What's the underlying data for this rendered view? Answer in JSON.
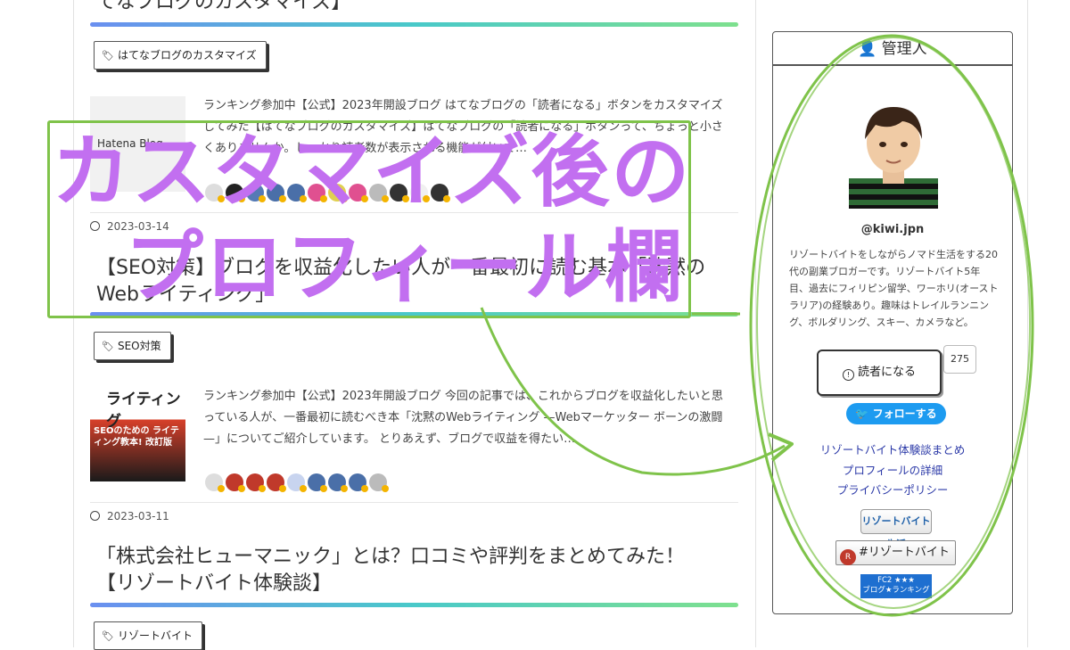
{
  "articles": {
    "a1": {
      "title_partial": "てなブログのカスタマイズ】",
      "tag": "はてなブログのカスタマイズ",
      "excerpt": "ランキング参加中【公式】2023年開設ブログ はてなブログの「読者になる」ボタンをカスタマイズしてみた【はてなブログのカスタマイズ】はてなブログの「読者になる」ボタンって、ちょっと小さくありませんか。しっかり読者数が表示される機能が付いて…",
      "thumb_label": "Hatena Blog"
    },
    "a2": {
      "date": "2023-03-14",
      "title": "【SEO対策】ブログを収益化したい人が一番最初に読む基本「沈黙のWebライティング」",
      "tag": "SEO対策",
      "excerpt": "ランキング参加中【公式】2023年開設ブログ 今回の記事では、これからブログを収益化したいと思っている人が、一番最初に読むべき本「沈黙のWebライティング —Webマーケッター ボーンの激闘—」についてご紹介しています。 とりあえず、ブログで収益を得たい…",
      "book_title": "ライティング",
      "book_sub": "SEOのための ライティング教本! 改訂版"
    },
    "a3": {
      "date": "2023-03-11",
      "title": "「株式会社ヒューマニック」とは？口コミや評判をまとめてみた！【リゾートバイト体験談】",
      "tag": "リゾートバイト"
    }
  },
  "profile": {
    "header": "管理人",
    "username": "@kiwi.jpn",
    "bio": "リゾートバイトをしながらノマド生活をする20代の副業ブロガーです。リゾートバイト5年目、過去にフィリピン留学、ワーホリ(オーストラリア)の経験あり。趣味はトレイルランニング、ボルダリング、スキー、カメラなど。",
    "read_button": "読者になる",
    "reader_count": "275",
    "follow_button": "フォローする",
    "links": [
      "リゾートバイト体験談まとめ",
      "プロフィールの詳細",
      "プライバシーポリシー"
    ],
    "banner_resort": "リゾートバイト生活",
    "banner_hashtag": "#リゾートバイト",
    "banner_fc2_line1": "FC2 ★★★",
    "banner_fc2_line2": "ブログ★ランキング"
  },
  "overlay": {
    "line1": "カスタマイズ後の",
    "line2": "プロフィール欄",
    "color": "#c26ff0",
    "annotation_color": "#7fc34a"
  }
}
